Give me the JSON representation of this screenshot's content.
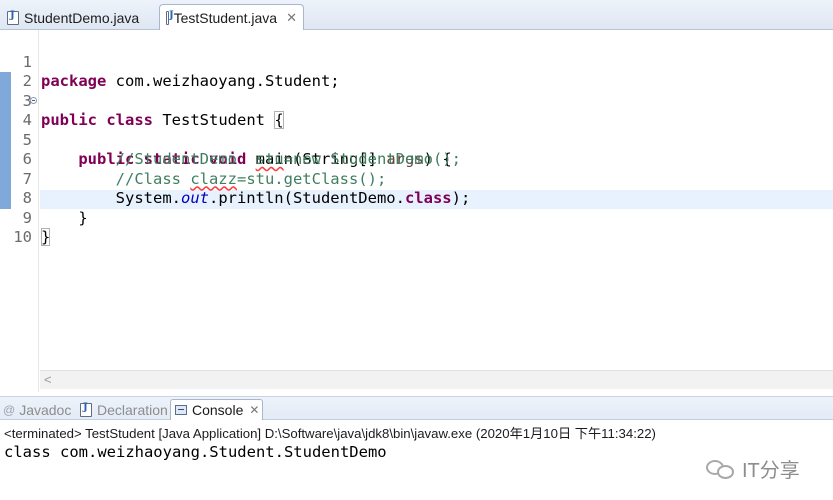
{
  "editor_tabs": [
    {
      "label": "StudentDemo.java",
      "active": false
    },
    {
      "label": "TestStudent.java",
      "active": true,
      "close": "✕"
    }
  ],
  "code": {
    "line_numbers": [
      "1",
      "2",
      "3",
      "4",
      "5",
      "6",
      "7",
      "8",
      "9",
      "10"
    ],
    "line1": {
      "kw": "package",
      "rest": " com.weizhaoyang.Student;"
    },
    "line3": {
      "kw1": "public",
      "kw2": "class",
      "name": " TestStudent ",
      "brace": "{"
    },
    "line4": {
      "kw1": "public",
      "kw2": "static",
      "kw3": "void",
      "rest": " main(String[] ",
      "param": "args",
      "end": ") {"
    },
    "line5": {
      "comment_a": "//StudentDemo  ",
      "comment_b": "stu",
      "comment_c": "=new StudentDemo();"
    },
    "line6": {
      "comment_a": "//Class ",
      "comment_b": "clazz",
      "comment_c": "=stu.getClass();"
    },
    "line7": {
      "a": "System.",
      "field": "out",
      "b": ".println(StudentDemo.",
      "kw": "class",
      "c": ");"
    },
    "line8": {
      "text": "}"
    },
    "line9": {
      "text": "}"
    }
  },
  "scroll": {
    "left_arrow": "<"
  },
  "panel_tabs": {
    "javadoc": "Javadoc",
    "declaration": "Declaration",
    "console": "Console",
    "console_close": "✕"
  },
  "console": {
    "status": "<terminated> TestStudent [Java Application] D:\\Software\\java\\jdk8\\bin\\javaw.exe (2020年1月10日 下午11:34:22)",
    "output": "class com.weizhaoyang.Student.StudentDemo"
  },
  "watermark": {
    "text": "IT分享"
  },
  "icons": {
    "java_file": "java-file-icon",
    "fold": "fold-collapse-icon",
    "console": "console-icon"
  }
}
